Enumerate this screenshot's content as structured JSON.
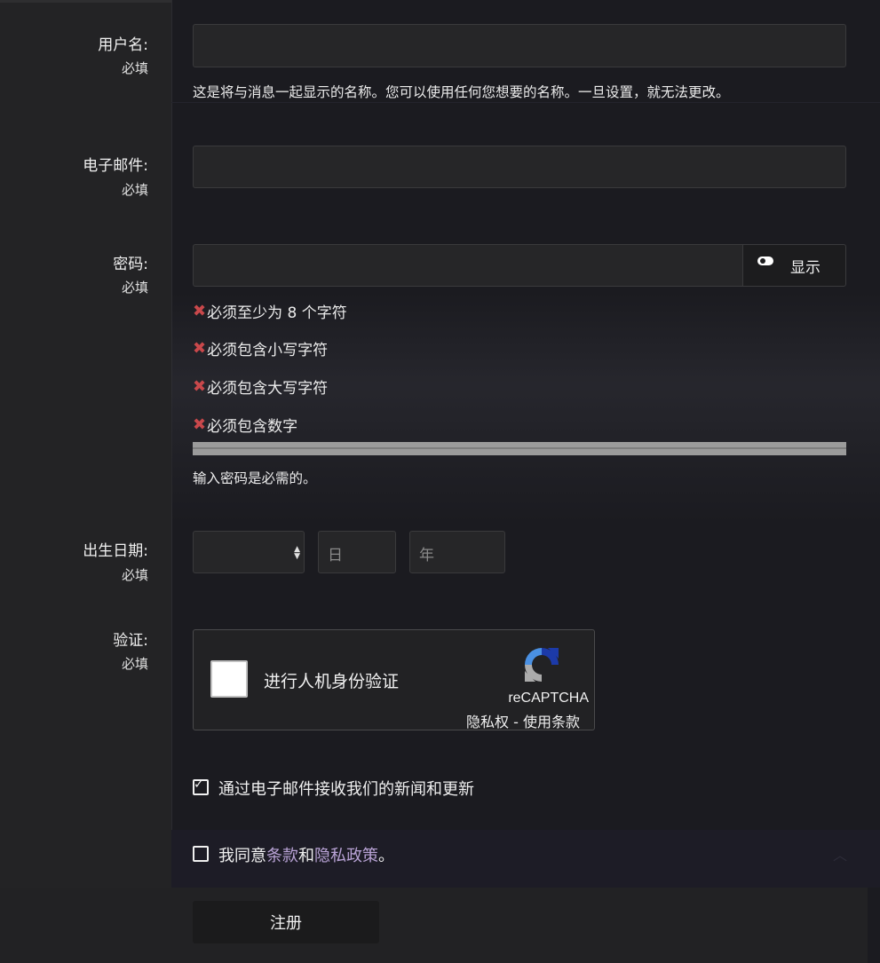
{
  "fields": {
    "username": {
      "label": "用户名:",
      "required": "必填",
      "value": "",
      "hint": "这是将与消息一起显示的名称。您可以使用任何您想要的名称。一旦设置，就无法更改。"
    },
    "email": {
      "label": "电子邮件:",
      "required": "必填",
      "value": ""
    },
    "password": {
      "label": "密码:",
      "required": "必填",
      "value": "",
      "show_label": "显示",
      "rules": [
        "必须至少为 8 个字符",
        "必须包含小写字符",
        "必须包含大写字符",
        "必须包含数字"
      ],
      "rule_status_icon": "cross-icon",
      "strength_fraction": 0,
      "hint": "输入密码是必需的。"
    },
    "dob": {
      "label": "出生日期:",
      "required": "必填",
      "month_value": "",
      "day_placeholder": "日",
      "year_placeholder": "年"
    },
    "verify": {
      "label": "验证:",
      "required": "必填"
    }
  },
  "captcha": {
    "prompt": "进行人机身份验证",
    "brand": "reCAPTCHA",
    "links": "隐私权 - 使用条款"
  },
  "options": {
    "newsletter": {
      "label": "通过电子邮件接收我们的新闻和更新",
      "checked": true
    },
    "terms": {
      "prefix": "我同意",
      "terms_link": "条款",
      "middle": "和",
      "privacy_link": "隐私政策",
      "suffix": "。",
      "checked": false
    }
  },
  "submit_label": "注册",
  "colors": {
    "error": "#c9484b",
    "link": "#b9a3d6",
    "background": "#1b1b20",
    "label_column": "#232325"
  }
}
